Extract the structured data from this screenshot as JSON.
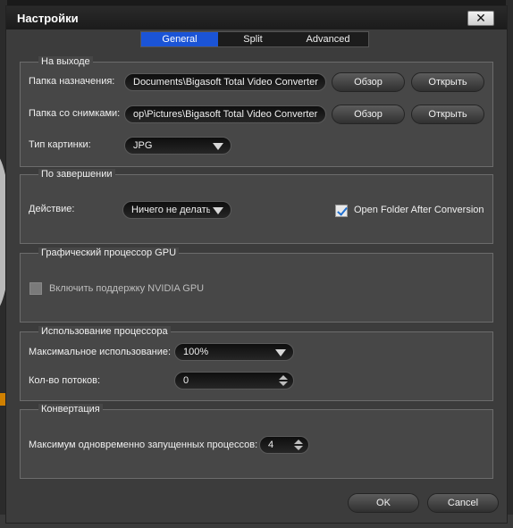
{
  "window": {
    "title": "Настройки",
    "close_label": "✕"
  },
  "tabs": [
    {
      "label": "General",
      "active": true
    },
    {
      "label": "Split",
      "active": false
    },
    {
      "label": "Advanced",
      "active": false
    }
  ],
  "output": {
    "title": "На выходе",
    "dest_label": "Папка назначения:",
    "dest_value": "Documents\\Bigasoft Total Video Converter",
    "snap_label": "Папка со снимками:",
    "snap_value": " op\\Pictures\\Bigasoft Total Video Converter",
    "browse_label": "Обзор",
    "open_label": "Открыть",
    "image_type_label": "Тип картинки:",
    "image_type_value": "JPG"
  },
  "completion": {
    "title": "По завершении",
    "action_label": "Действие:",
    "action_value": "Ничего не делать",
    "open_folder_label": "Open Folder After Conversion",
    "open_folder_checked": true
  },
  "gpu": {
    "title": "Графический процессор GPU",
    "enable_label": "Включить поддержку NVIDIA GPU",
    "enabled": false
  },
  "cpu": {
    "title": "Использование процессора",
    "max_usage_label": "Максимальное использование:",
    "max_usage_value": "100%",
    "threads_label": "Кол-во потоков:",
    "threads_value": "0"
  },
  "conversion": {
    "title": "Конвертация",
    "max_processes_label": "Максимум одновременно запущенных процессов:",
    "max_processes_value": "4"
  },
  "footer": {
    "ok_label": "OK",
    "cancel_label": "Cancel"
  },
  "colors": {
    "accent": "#1b54d6",
    "dialog_bg": "#3c3c3c",
    "group_bg": "#474747"
  },
  "icons": {
    "close": "close-icon",
    "dropdown": "chevron-down-icon",
    "spinner": "spinner-arrows-icon",
    "check": "check-icon"
  }
}
